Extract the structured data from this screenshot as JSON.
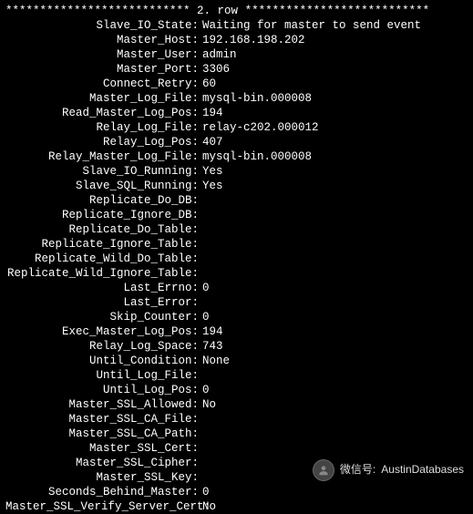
{
  "header": {
    "stars_left": "*************************** ",
    "row_label": "2. row",
    "stars_right": " ***************************"
  },
  "rows": [
    {
      "label": "Slave_IO_State",
      "value": "Waiting for master to send event"
    },
    {
      "label": "Master_Host",
      "value": "192.168.198.202"
    },
    {
      "label": "Master_User",
      "value": "admin"
    },
    {
      "label": "Master_Port",
      "value": "3306"
    },
    {
      "label": "Connect_Retry",
      "value": "60"
    },
    {
      "label": "Master_Log_File",
      "value": "mysql-bin.000008"
    },
    {
      "label": "Read_Master_Log_Pos",
      "value": "194"
    },
    {
      "label": "Relay_Log_File",
      "value": "relay-c202.000012"
    },
    {
      "label": "Relay_Log_Pos",
      "value": "407"
    },
    {
      "label": "Relay_Master_Log_File",
      "value": "mysql-bin.000008"
    },
    {
      "label": "Slave_IO_Running",
      "value": "Yes"
    },
    {
      "label": "Slave_SQL_Running",
      "value": "Yes"
    },
    {
      "label": "Replicate_Do_DB",
      "value": ""
    },
    {
      "label": "Replicate_Ignore_DB",
      "value": ""
    },
    {
      "label": "Replicate_Do_Table",
      "value": ""
    },
    {
      "label": "Replicate_Ignore_Table",
      "value": ""
    },
    {
      "label": "Replicate_Wild_Do_Table",
      "value": ""
    },
    {
      "label": "Replicate_Wild_Ignore_Table",
      "value": ""
    },
    {
      "label": "Last_Errno",
      "value": "0"
    },
    {
      "label": "Last_Error",
      "value": ""
    },
    {
      "label": "Skip_Counter",
      "value": "0"
    },
    {
      "label": "Exec_Master_Log_Pos",
      "value": "194"
    },
    {
      "label": "Relay_Log_Space",
      "value": "743"
    },
    {
      "label": "Until_Condition",
      "value": "None"
    },
    {
      "label": "Until_Log_File",
      "value": ""
    },
    {
      "label": "Until_Log_Pos",
      "value": "0"
    },
    {
      "label": "Master_SSL_Allowed",
      "value": "No"
    },
    {
      "label": "Master_SSL_CA_File",
      "value": ""
    },
    {
      "label": "Master_SSL_CA_Path",
      "value": ""
    },
    {
      "label": "Master_SSL_Cert",
      "value": ""
    },
    {
      "label": "Master_SSL_Cipher",
      "value": ""
    },
    {
      "label": "Master_SSL_Key",
      "value": ""
    },
    {
      "label": "Seconds_Behind_Master",
      "value": "0"
    },
    {
      "label": "Master_SSL_Verify_Server_Cert",
      "value": "No"
    }
  ],
  "footer": {
    "prefix": "微信号:",
    "account": "AustinDatabases"
  }
}
